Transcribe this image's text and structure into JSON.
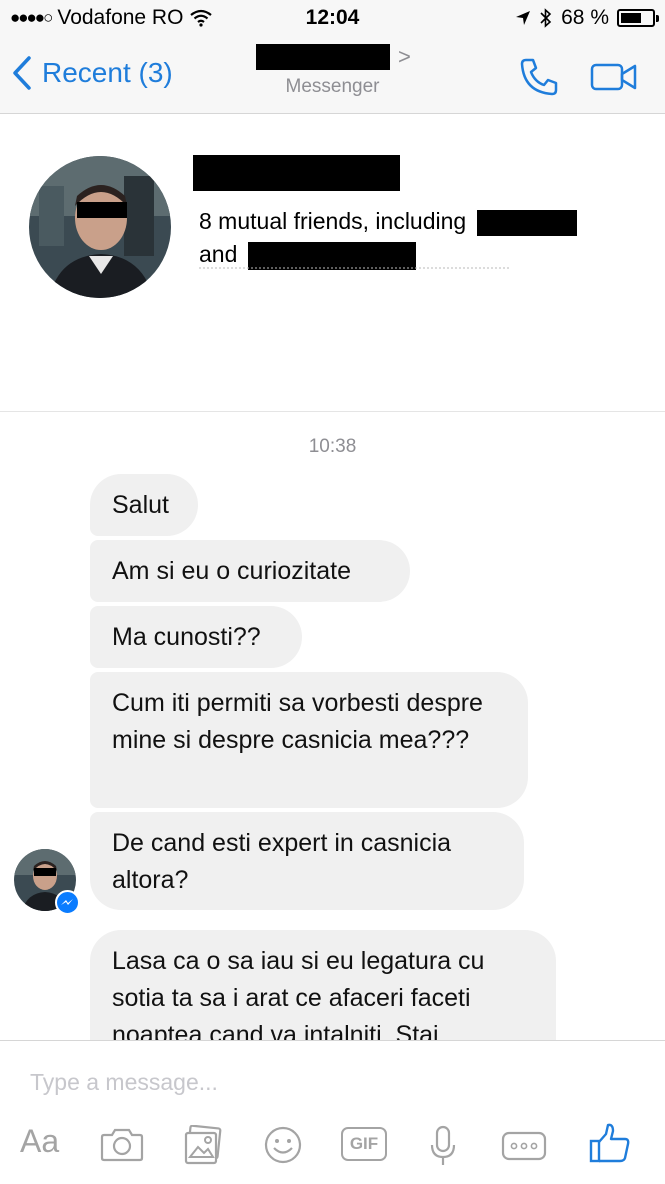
{
  "status_bar": {
    "signal": "●●●●○",
    "carrier": "Vodafone RO",
    "time": "12:04",
    "battery_percent": "68 %",
    "battery_level": 0.68
  },
  "nav": {
    "back_label": "Recent (3)",
    "subtitle": "Messenger",
    "chevron": ">",
    "accent_color": "#1f7ddb"
  },
  "profile": {
    "mutual_prefix": "8 mutual friends, including",
    "mutual_and": "and"
  },
  "conversation": {
    "timestamp": "10:38",
    "messages": [
      "Salut",
      "Am si eu o curiozitate",
      "Ma cunosti??",
      "Cum iti permiti sa vorbesti despre mine si despre casnicia mea???",
      "De cand esti expert in casnicia altora?",
      "Lasa ca o sa iau si eu legatura cu sotia ta sa i arat ce afaceri faceti noaptea cand va intalniti. Stai"
    ]
  },
  "composer": {
    "placeholder": "Type a message...",
    "aa_label": "Aa",
    "gif_label": "GIF",
    "icons": [
      "text-format-icon",
      "camera-icon",
      "photo-icon",
      "emoji-icon",
      "gif-icon",
      "microphone-icon",
      "more-icon",
      "like-icon"
    ]
  }
}
